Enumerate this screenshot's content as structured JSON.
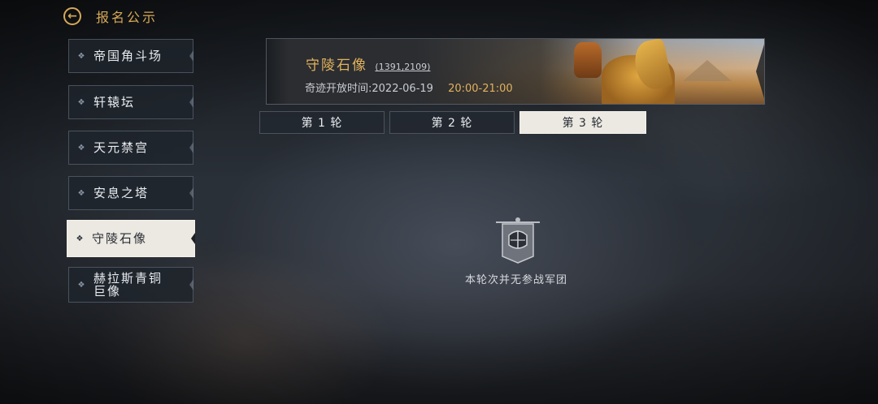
{
  "header": {
    "back_icon": "arrow-left-icon",
    "title": "报名公示"
  },
  "sidebar": {
    "items": [
      {
        "label": "帝国角斗场",
        "active": false
      },
      {
        "label": "轩辕坛",
        "active": false
      },
      {
        "label": "天元禁宫",
        "active": false
      },
      {
        "label": "安息之塔",
        "active": false
      },
      {
        "label": "守陵石像",
        "active": true
      },
      {
        "label": "赫拉斯青铜巨像",
        "active": false
      }
    ],
    "bullet_icon": "diamond-bullet-icon"
  },
  "banner": {
    "name": "守陵石像",
    "coords": "(1391,2109)",
    "time_label": "奇迹开放时间:2022-06-19",
    "time_hours": "20:00-21:00",
    "image": "sphinx-statue-illustration"
  },
  "tabs": [
    {
      "label": "第 1 轮",
      "active": false
    },
    {
      "label": "第 2 轮",
      "active": false
    },
    {
      "label": "第 3 轮",
      "active": true
    }
  ],
  "empty_state": {
    "icon": "legion-banner-helmet-icon",
    "text": "本轮次并无参战军团"
  },
  "colors": {
    "accent_gold": "#d8a957",
    "active_bg": "#ece9e2",
    "panel_bg": "#1e242c"
  }
}
